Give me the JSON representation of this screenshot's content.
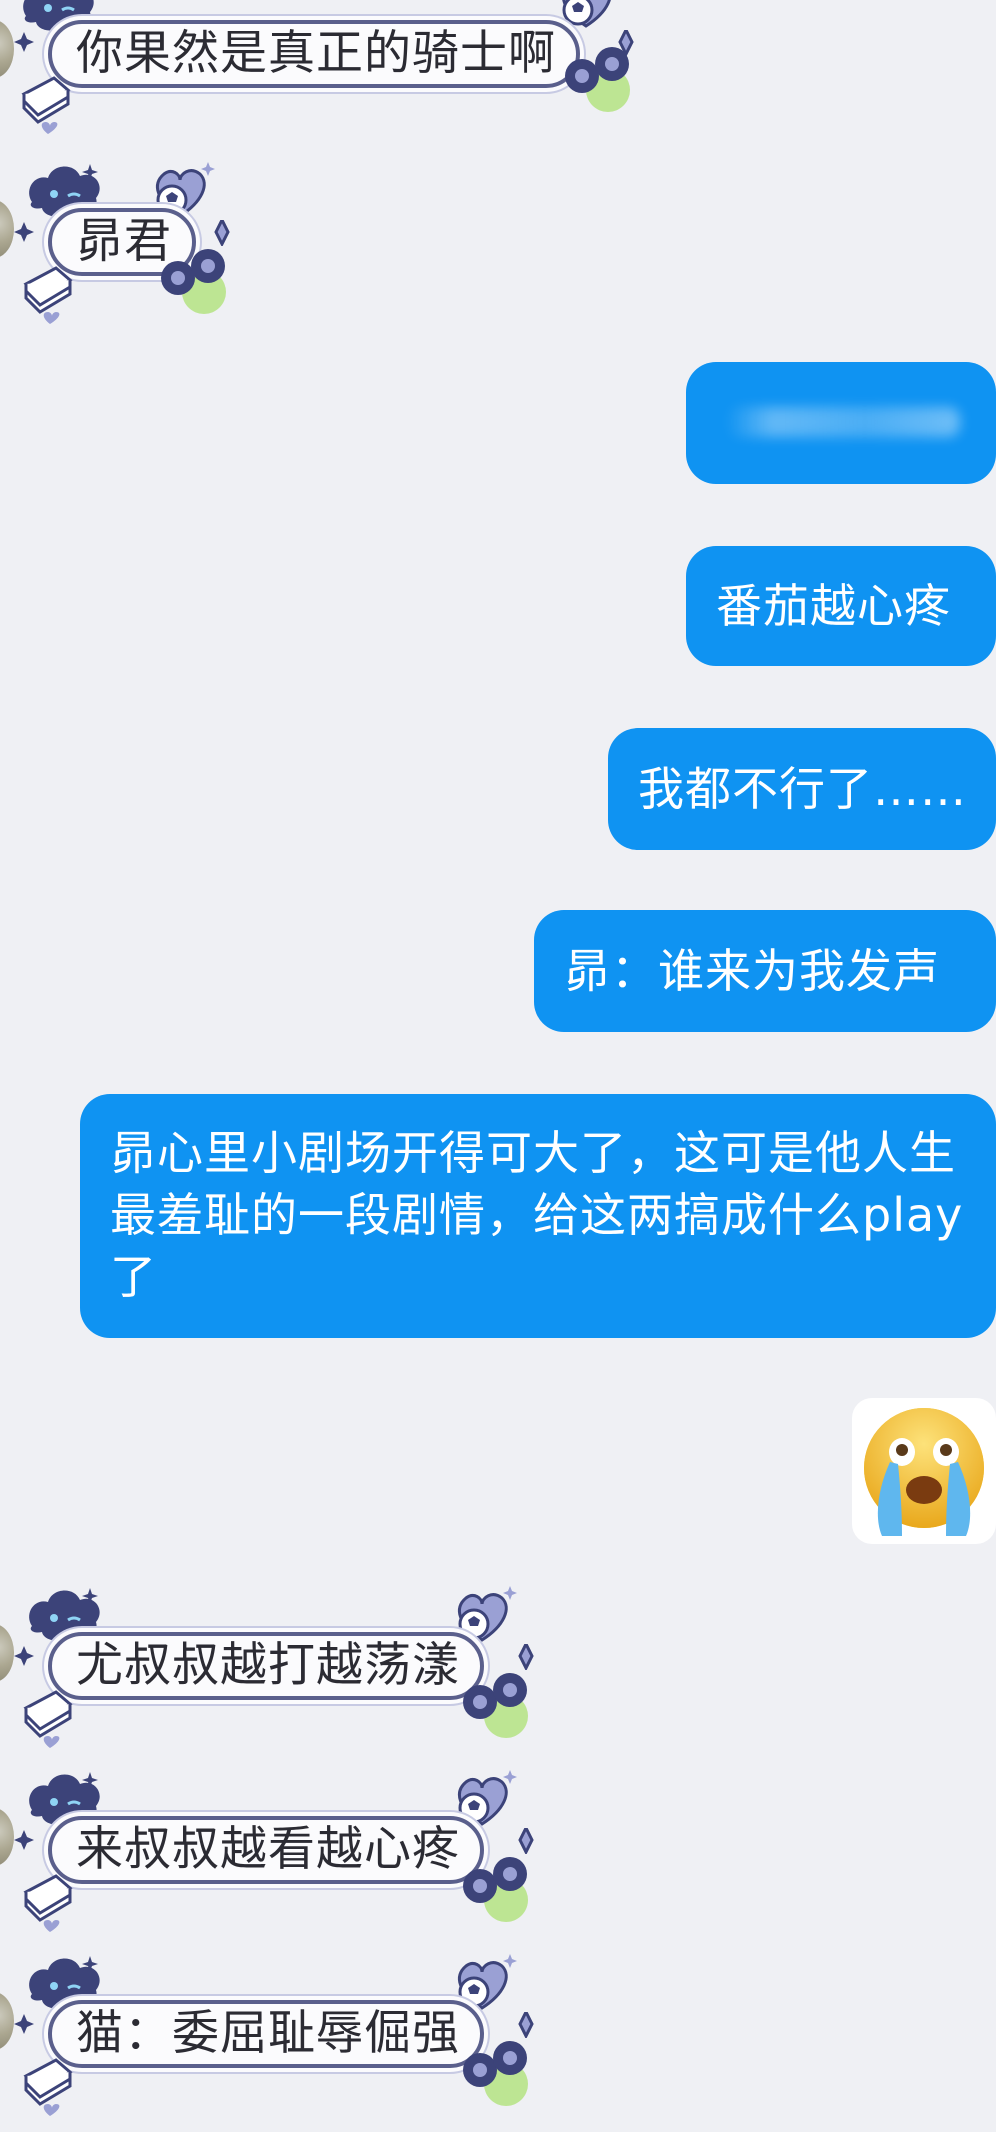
{
  "incoming": [
    {
      "text": "你果然是真正的骑士啊"
    },
    {
      "text": "昴君"
    },
    {
      "text": "尤叔叔越打越荡漾"
    },
    {
      "text": "来叔叔越看越心疼"
    },
    {
      "text": "猫：委屈耻辱倔强"
    }
  ],
  "outgoing": [
    {
      "text": ""
    },
    {
      "text": "番茄越心疼"
    },
    {
      "text": "我都不行了……"
    },
    {
      "text": "昴：谁来为我发声"
    },
    {
      "text": "昴心里小剧场开得可大了，这可是他人生最羞耻的一段剧情，给这两搞成什么play了"
    }
  ],
  "sticker": {
    "icon": "crying-emoji-sticker"
  },
  "colors": {
    "background": "#eff0f4",
    "outgoing_bubble": "#0f93f2",
    "incoming_bubble": "#fbfbfd",
    "decoration_navy": "#3c4379",
    "decoration_green": "#a8e06a"
  }
}
